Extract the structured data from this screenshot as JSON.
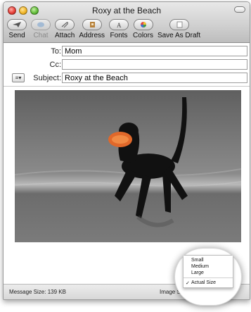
{
  "window": {
    "title": "Roxy at the Beach"
  },
  "toolbar": {
    "items": [
      {
        "label": "Send",
        "icon": "send-icon"
      },
      {
        "label": "Chat",
        "icon": "chat-icon"
      },
      {
        "label": "Attach",
        "icon": "paperclip-icon"
      },
      {
        "label": "Address",
        "icon": "address-book-icon"
      },
      {
        "label": "Fonts",
        "icon": "fonts-icon"
      },
      {
        "label": "Colors",
        "icon": "color-wheel-icon"
      },
      {
        "label": "Save As Draft",
        "icon": "draft-icon"
      }
    ]
  },
  "headers": {
    "to_label": "To:",
    "to_value": "Mom",
    "cc_label": "Cc:",
    "cc_value": "",
    "subject_label": "Subject:",
    "subject_value": "Roxy at the Beach"
  },
  "status": {
    "message_size": "Message Size: 139 KB",
    "image_size_label": "Image Siz"
  },
  "image_size_menu": {
    "items": [
      "Small",
      "Medium",
      "Large"
    ],
    "selected": "Actual Size"
  }
}
